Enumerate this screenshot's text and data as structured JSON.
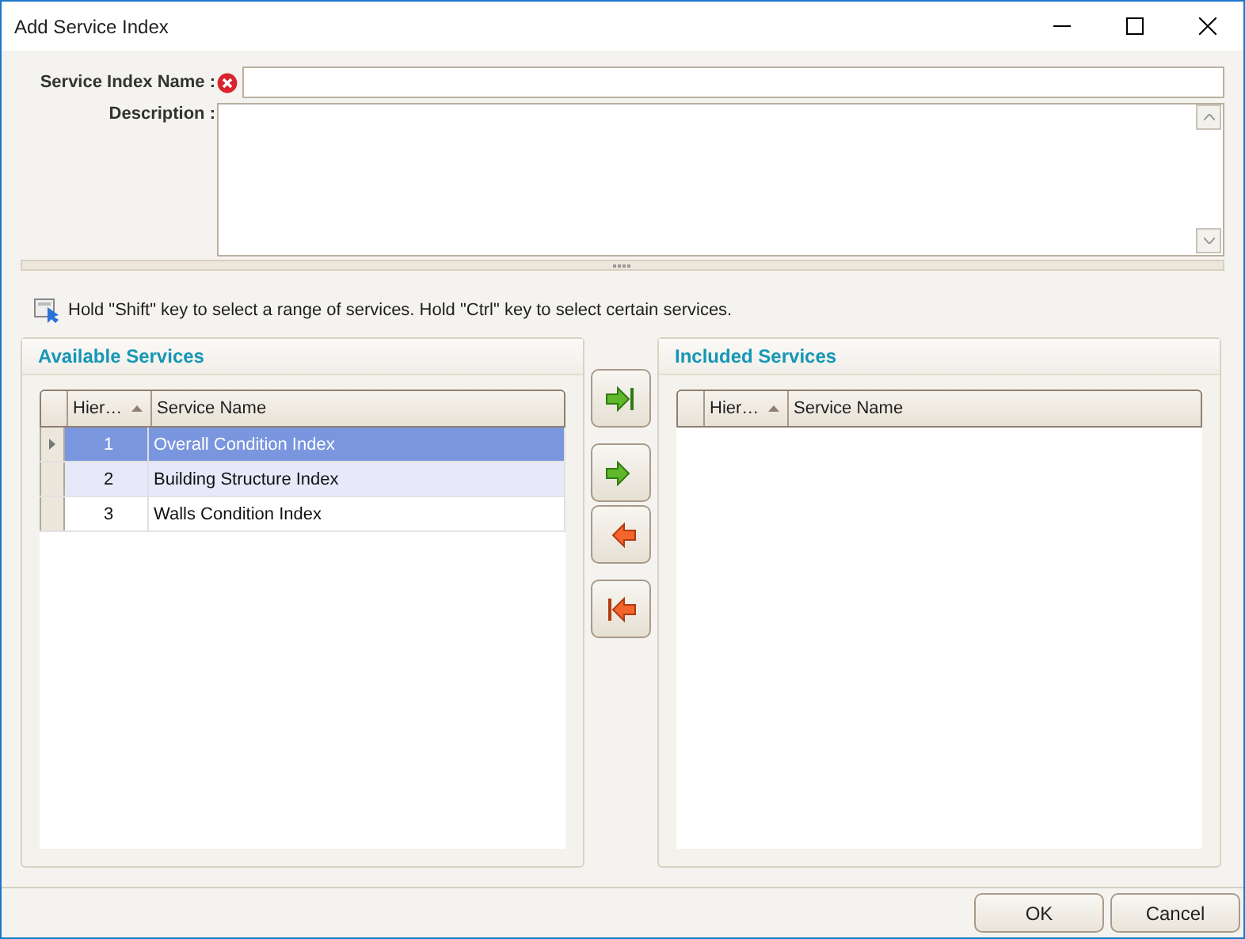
{
  "window": {
    "title": "Add Service Index"
  },
  "form": {
    "name_label": "Service Index Name :",
    "name_error": true,
    "description_label": "Description :"
  },
  "hint": "Hold \"Shift\" key to select a range of services. Hold \"Ctrl\" key to select certain services.",
  "available": {
    "title": "Available Services",
    "columns": [
      "Hier…",
      "Service Name"
    ],
    "rows": [
      {
        "hierarchy": "1",
        "name": "Overall Condition Index",
        "selected": true,
        "hovered": false
      },
      {
        "hierarchy": "2",
        "name": "Building Structure Index",
        "selected": false,
        "hovered": true
      },
      {
        "hierarchy": "3",
        "name": "Walls Condition Index",
        "selected": false,
        "hovered": false
      }
    ]
  },
  "transfer_buttons": [
    {
      "kind": "add-all"
    },
    {
      "kind": "add"
    },
    {
      "kind": "remove"
    },
    {
      "kind": "remove-all"
    }
  ],
  "included": {
    "title": "Included Services",
    "columns": [
      "Hier…",
      "Service Name"
    ]
  },
  "buttons": [
    "OK",
    "Cancel"
  ]
}
